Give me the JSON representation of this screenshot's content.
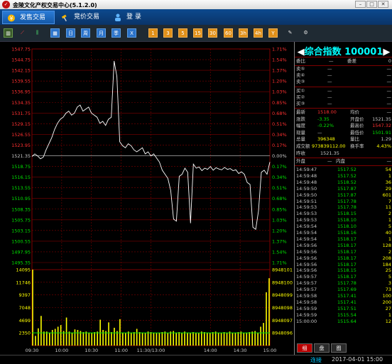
{
  "window": {
    "title": "金陵文化产权交易中心(5.1.2.0)"
  },
  "tabs": [
    {
      "label": "发售交易",
      "active": true
    },
    {
      "label": "竞价交易",
      "active": false
    },
    {
      "label": "登  录",
      "active": false
    }
  ],
  "toolbar": {
    "icons": [
      "candlestick-chart-icon",
      "line-chart-icon",
      "bar-chart-icon",
      "grid-icon",
      "calendar-day-icon",
      "calendar-week-icon",
      "calendar-month-icon",
      "calendar-season-icon",
      "calendar-year-icon"
    ],
    "blue_labels": [
      "",
      "",
      "",
      "日",
      "周",
      "月",
      "季",
      "X"
    ],
    "orange_labels": [
      "1",
      "3",
      "5",
      "15",
      "30",
      "60",
      "3h",
      "4h",
      "Y"
    ]
  },
  "chart_data": {
    "type": "line",
    "price_axis": [
      "1547.75",
      "1544.75",
      "1542.15",
      "1539.55",
      "1536.95",
      "1534.35",
      "1531.75",
      "1529.15",
      "1526.55",
      "1523.95",
      "1521.35",
      "1518.75",
      "1516.15",
      "1513.55",
      "1510.95",
      "1508.35",
      "1505.75",
      "1503.15",
      "1500.55",
      "1497.95",
      "1495.35"
    ],
    "pct_axis": [
      "1.71%",
      "1.54%",
      "1.37%",
      "1.20%",
      "1.03%",
      "0.85%",
      "0.68%",
      "0.51%",
      "0.34%",
      "0.17%",
      "0.00%",
      "0.17%",
      "0.34%",
      "0.51%",
      "0.68%",
      "0.85%",
      "1.03%",
      "1.20%",
      "1.37%",
      "1.54%",
      "1.71%"
    ],
    "volume_axis": [
      "14095",
      "11746",
      "9397",
      "7048",
      "4699",
      "2350"
    ],
    "volume_right": [
      "8948101",
      "8948100",
      "8948099",
      "8948098",
      "8948097",
      "8948096"
    ],
    "time_labels": [
      "09:30",
      "10:00",
      "10:30",
      "11:00",
      "11:30/13:00",
      "14:00",
      "14:30",
      "15:00"
    ],
    "prev_close": 1521.35,
    "ylim": [
      1495.35,
      1547.75
    ],
    "price": [
      1521.35,
      1522.0,
      1521.5,
      1520.8,
      1521.2,
      1523.0,
      1524.5,
      1526.0,
      1528.0,
      1529.5,
      1530.5,
      1531.0,
      1532.0,
      1532.5,
      1531.5,
      1532.0,
      1533.5,
      1534.0,
      1532.5,
      1533.0,
      1533.5,
      1532.0,
      1531.5,
      1531.0,
      1529.5,
      1530.0,
      1529.0,
      1530.5,
      1531.0,
      1544.8,
      1541.0,
      1525.0,
      1524.0,
      1523.5,
      1524.5,
      1524.0,
      1523.0,
      1522.5,
      1523.0,
      1523.5,
      1522.0,
      1522.5,
      1521.5,
      1522.0,
      1521.0,
      1520.0,
      1518.0,
      1517.0,
      1516.0,
      1513.0,
      1506.0,
      1505.5,
      1516.5,
      1517.0,
      1518.5,
      1517.5,
      1505.0,
      1519.5,
      1518.5,
      1518.8,
      1517.9,
      1518.5,
      1518.2,
      1518.9,
      1518.0,
      1518.6,
      1518.3,
      1518.1,
      1518.7,
      1518.2,
      1518.4,
      1517.9,
      1518.1,
      1517.2,
      1517.6,
      1517.0,
      1515.0,
      1514.5,
      1504.0,
      1503.5,
      1508.0,
      1517.5,
      1518.0,
      1517.0,
      1520.0
    ],
    "volume_baseline": 2350,
    "volume": [
      14095,
      1800,
      3200,
      5500,
      2600,
      2600,
      2400,
      2900,
      3100,
      3500,
      3800,
      2700,
      5200,
      2600,
      2400,
      3000,
      2900,
      2700,
      2500,
      2600,
      2400,
      2300,
      2500,
      2600,
      4800,
      2900,
      2700,
      4300,
      2500,
      3300,
      2700,
      4900,
      2400,
      2300,
      2600,
      2400,
      2500,
      3100,
      2500,
      2400,
      2300,
      2600,
      2500,
      2400,
      2300,
      2400,
      2500,
      2600,
      2300,
      2600,
      2700,
      2400,
      2500,
      2300,
      2600,
      2400,
      2300,
      2500,
      2400,
      2300,
      2600,
      2500,
      2400,
      2300,
      2500,
      2600,
      2400,
      2300,
      2500,
      2400,
      2600,
      2300,
      2400,
      2500,
      2600,
      2300,
      2400,
      2500,
      2600,
      2700,
      2400,
      3500,
      4200,
      9900,
      12500
    ]
  },
  "quote": {
    "title": "综合指数 100001",
    "wei_bi_label": "委比",
    "wei_bi_value": "—",
    "wei_cha_label": "委差",
    "wei_cha_value": "0",
    "sell": [
      {
        "label": "卖⑤",
        "v": "—"
      },
      {
        "label": "卖④",
        "v": "—"
      },
      {
        "label": "卖③",
        "v": "—"
      }
    ],
    "buy": [
      {
        "label": "买①",
        "v": "—"
      },
      {
        "label": "买②",
        "v": "—"
      },
      {
        "label": "买③",
        "v": "—"
      }
    ],
    "stats": [
      {
        "l1": "最新",
        "v1": "1518.00",
        "l2": "均价",
        "v2": "—",
        "c1": "#ff3030",
        "c2": "#c8c8c8"
      },
      {
        "l1": "涨跌",
        "v1": "-3.35",
        "l2": "开盘价",
        "v2": "1521.35",
        "c1": "#00e000",
        "c2": "#c8c8c8"
      },
      {
        "l1": "幅度",
        "v1": "-0.22%",
        "l2": "最高价",
        "v2": "1547.32",
        "c1": "#00e000",
        "c2": "#ff3030"
      },
      {
        "l1": "现量",
        "v1": "—",
        "l2": "最低价",
        "v2": "1501.91",
        "c1": "#c8c8c8",
        "c2": "#00e000"
      },
      {
        "l1": "总量",
        "v1": "396348",
        "l2": "量比",
        "v2": "1.29",
        "c1": "#ffff00",
        "c2": "#c8c8c8"
      },
      {
        "l1": "成交额",
        "v1": "973839112.00",
        "l2": "换手率",
        "v2": "4.43%",
        "c1": "#ffff00",
        "c2": "#ffff00"
      }
    ],
    "prev_label": "昨收",
    "prev_value": "1521.35",
    "outer_label": "外盘",
    "outer_value": "—",
    "inner_label": "内盘",
    "inner_value": "—"
  },
  "ticks": [
    [
      "14:59:47",
      "1517.52",
      "54"
    ],
    [
      "14:59:48",
      "1517.52",
      "1"
    ],
    [
      "14:59:48",
      "1518.52",
      "36"
    ],
    [
      "14:59:50",
      "1517.87",
      "29"
    ],
    [
      "14:59:50",
      "1517.87",
      "601"
    ],
    [
      "14:59:51",
      "1517.78",
      "7"
    ],
    [
      "14:59:53",
      "1517.78",
      "11"
    ],
    [
      "14:59:53",
      "1518.15",
      "2"
    ],
    [
      "14:59:53",
      "1518.10",
      "1"
    ],
    [
      "14:59:54",
      "1518.10",
      "5"
    ],
    [
      "14:59:54",
      "1518.16",
      "40"
    ],
    [
      "14:59:54",
      "1518.17",
      "1"
    ],
    [
      "14:59:56",
      "1518.17",
      "128"
    ],
    [
      "14:59:56",
      "1518.17",
      "2"
    ],
    [
      "14:59:56",
      "1518.17",
      "208"
    ],
    [
      "14:59:56",
      "1518.17",
      "184"
    ],
    [
      "14:59:56",
      "1518.15",
      "25"
    ],
    [
      "14:59:57",
      "1518.17",
      "5"
    ],
    [
      "14:59:57",
      "1517.78",
      "3"
    ],
    [
      "14:59:57",
      "1517.69",
      "73"
    ],
    [
      "14:59:58",
      "1517.41",
      "100"
    ],
    [
      "14:59:58",
      "1517.41",
      "200"
    ],
    [
      "14:59:59",
      "1517.51",
      "27"
    ],
    [
      "14:59:59",
      "1515.54",
      "1"
    ],
    [
      "15:00:00",
      "1515.64",
      "12"
    ]
  ],
  "right_tabs": [
    "细",
    "盘",
    "图"
  ],
  "status": {
    "conn": "连接",
    "time": "2017-04-01 15:00"
  }
}
